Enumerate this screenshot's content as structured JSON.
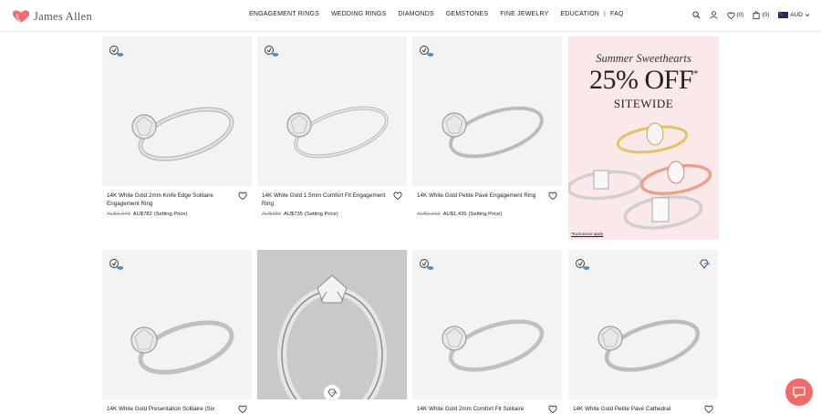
{
  "header": {
    "brand": "James Allen",
    "nav": [
      "ENGAGEMENT RINGS",
      "WEDDING RINGS",
      "DIAMONDS",
      "GEMSTONES",
      "FINE JEWELRY",
      "EDUCATION",
      "FAQ"
    ],
    "nav_separator": "|",
    "wishlist_count": "(0)",
    "cart_count": "(0)",
    "currency": "AUD"
  },
  "products": [
    {
      "title": "14K White Gold 2mm Knife Edge Solitaire Engagement Ring",
      "was": "AU$1,043",
      "price": "AU$782",
      "note": "(Setting Price)"
    },
    {
      "title": "14K White Gold 1.5mm Comfort Fit Engagement Ring",
      "was": "AU$980",
      "price": "AU$735",
      "note": "(Setting Price)"
    },
    {
      "title": "14K White Gold Petite Pavé Engagement Ring",
      "was": "AU$1,913",
      "price": "AU$1,435",
      "note": "(Setting Price)"
    },
    {
      "title": "14K White Gold Presentation Solitaire (Six"
    },
    {
      "title": ""
    },
    {
      "title": "14K White Gold 2mm Comfort Fit Solitaire"
    },
    {
      "title": "14K White Gold Petite Pavé Cathedral"
    }
  ],
  "promo": {
    "line1": "Summer Sweethearts",
    "line2": "25% OFF",
    "line2_mark": "*",
    "line3": "SITEWIDE",
    "footnote": "*Exclusions apply"
  },
  "colors": {
    "accent": "#ef6b6b",
    "promo_bg": "#fbe9ea",
    "card_bg": "#f3f3f3"
  }
}
